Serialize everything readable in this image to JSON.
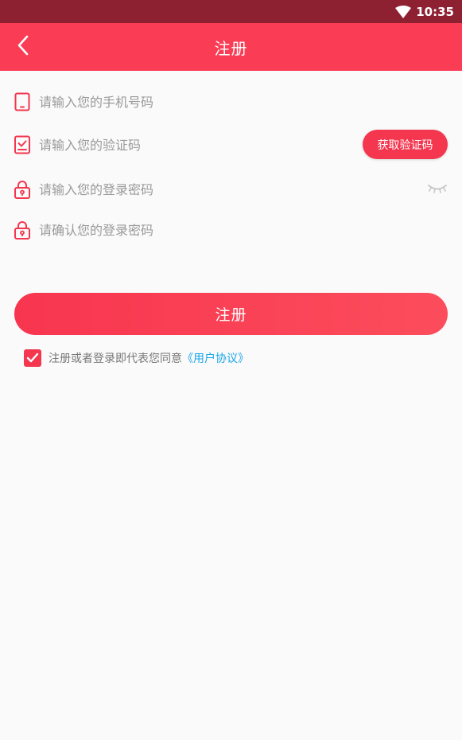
{
  "status_bar": {
    "time": "10:35",
    "icon": "wifi-icon"
  },
  "app_bar": {
    "title": "注册",
    "back_icon": "back-arrow-icon"
  },
  "form": {
    "phone": {
      "placeholder": "请输入您的手机号码",
      "value": "",
      "icon": "phone-icon"
    },
    "code": {
      "placeholder": "请输入您的验证码",
      "value": "",
      "icon": "code-icon",
      "button_label": "获取验证码"
    },
    "password": {
      "placeholder": "请输入您的登录密码",
      "value": "",
      "icon": "lock-icon",
      "toggle_icon": "eye-closed-icon"
    },
    "confirm_password": {
      "placeholder": "请确认您的登录密码",
      "value": "",
      "icon": "lock-icon"
    }
  },
  "submit_label": "注册",
  "agreement": {
    "checked": true,
    "text": "注册或者登录即代表您同意",
    "link_text": "《用户协议》"
  },
  "colors": {
    "accent": "#fa3c55",
    "status_bar": "#8e2131",
    "link": "#1aa6e8"
  }
}
